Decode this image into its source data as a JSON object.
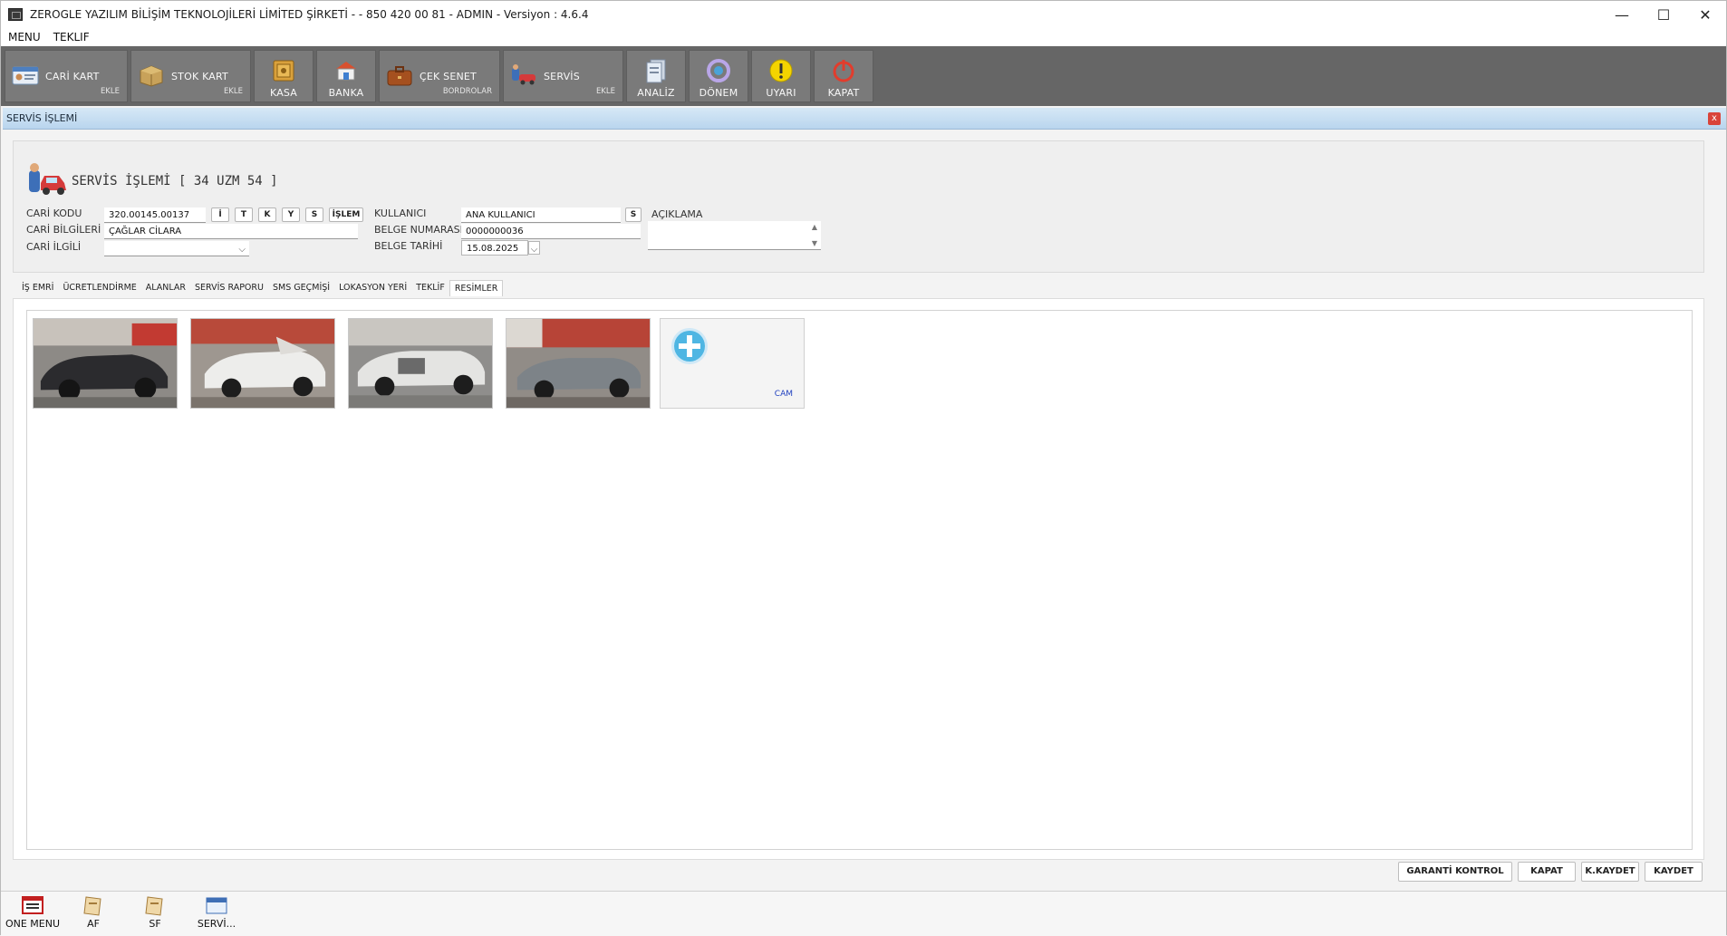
{
  "window": {
    "title": "ZEROGLE YAZILIM BİLİŞİM TEKNOLOJİLERİ LİMİTED ŞİRKETİ -  - 850 420 00 81 - ADMIN -  Versiyon : 4.6.4",
    "minimize": "—",
    "maximize": "☐",
    "close": "✕"
  },
  "menu": {
    "items": [
      "MENU",
      "TEKLIF"
    ]
  },
  "toolbar": {
    "cari_kart": {
      "label": "CARİ KART",
      "sub": "EKLE"
    },
    "stok_kart": {
      "label": "STOK KART",
      "sub": "EKLE"
    },
    "kasa": {
      "label": "KASA"
    },
    "banka": {
      "label": "BANKA"
    },
    "cek_senet": {
      "label": "ÇEK SENET",
      "sub": "BORDROLAR"
    },
    "servis": {
      "label": "SERVİS",
      "sub": "EKLE"
    },
    "analiz": {
      "label": "ANALİZ"
    },
    "donem": {
      "label": "DÖNEM"
    },
    "uyari": {
      "label": "UYARI"
    },
    "kapat": {
      "label": "KAPAT"
    }
  },
  "child": {
    "title": "SERVİS İŞLEMİ",
    "close": "x",
    "heading": "SERVİS İŞLEMİ [ 34 UZM 54 ]"
  },
  "form": {
    "cari_kodu_label": "CARİ KODU",
    "cari_kodu_value": "320.00145.00137",
    "cari_bilgileri_label": "CARİ BİLGİLERİ",
    "cari_bilgileri_value": "ÇAĞLAR CİLARA",
    "cari_ilgili_label": "CARİ İLGİLİ",
    "cari_ilgili_value": "",
    "btn_i": "İ",
    "btn_t": "T",
    "btn_k": "K",
    "btn_y": "Y",
    "btn_s": "S",
    "btn_islem": "İŞLEM",
    "kullanici_label": "KULLANICI",
    "kullanici_value": "ANA KULLANICI",
    "kullanici_btn": "S",
    "belge_no_label": "BELGE NUMARASI",
    "belge_no_value": "0000000036",
    "belge_tarihi_label": "BELGE TARİHİ",
    "belge_tarihi_value": "15.08.2025",
    "aciklama_label": "AÇIKLAMA",
    "aciklama_value": ""
  },
  "tabs": [
    "İŞ EMRİ",
    "ÜCRETLENDİRME",
    "ALANLAR",
    "SERVİS RAPORU",
    "SMS GEÇMİŞİ",
    "LOKASYON YERİ",
    "TEKLİF",
    "RESİMLER"
  ],
  "active_tab": "RESİMLER",
  "images": {
    "add_tile_label": "CAM"
  },
  "bottom_buttons": {
    "garanti": "GARANTİ KONTROL",
    "kapat": "KAPAT",
    "kkaydet": "K.KAYDET",
    "kaydet": "KAYDET"
  },
  "taskbar": {
    "items": [
      "ONE MENU",
      "AF",
      "SF",
      "SERVİ..."
    ]
  }
}
